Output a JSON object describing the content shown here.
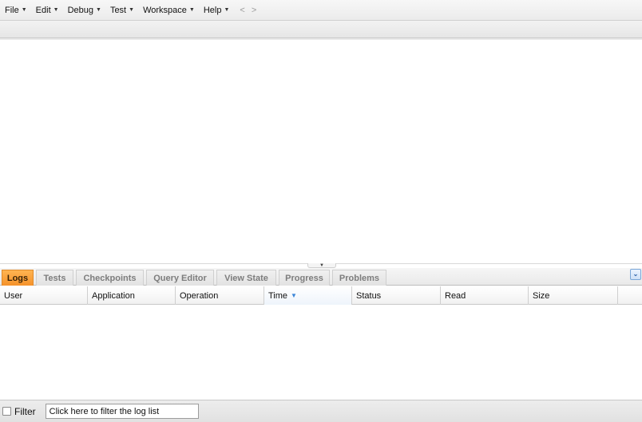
{
  "menubar": {
    "items": [
      {
        "label": "File"
      },
      {
        "label": "Edit"
      },
      {
        "label": "Debug"
      },
      {
        "label": "Test"
      },
      {
        "label": "Workspace"
      },
      {
        "label": "Help"
      }
    ],
    "back_arrow": "<",
    "forward_arrow": ">"
  },
  "bottom_panel": {
    "tabs": [
      {
        "label": "Logs",
        "active": true
      },
      {
        "label": "Tests"
      },
      {
        "label": "Checkpoints"
      },
      {
        "label": "Query Editor"
      },
      {
        "label": "View State"
      },
      {
        "label": "Progress"
      },
      {
        "label": "Problems"
      }
    ],
    "active_tab_color": "#f7a13a",
    "columns": [
      {
        "label": "User"
      },
      {
        "label": "Application"
      },
      {
        "label": "Operation"
      },
      {
        "label": "Time",
        "sorted": "descending"
      },
      {
        "label": "Status"
      },
      {
        "label": "Read"
      },
      {
        "label": "Size"
      }
    ],
    "rows": []
  },
  "filter": {
    "checked": false,
    "label": "Filter",
    "placeholder": "Click here to filter the log list"
  }
}
